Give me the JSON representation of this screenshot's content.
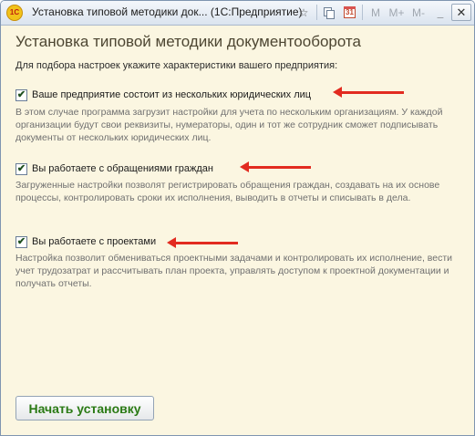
{
  "window": {
    "app_icon_text": "1С",
    "title": "Установка типовой методики док... (1С:Предприятие)",
    "toolbar": {
      "star": "☆",
      "m": "M",
      "m_plus": "M+",
      "m_minus": "M-",
      "minimize": "_",
      "maximize": "□",
      "close": "✕",
      "calendar_day": "31"
    }
  },
  "page": {
    "title": "Установка типовой методики документооборота",
    "intro": "Для подбора настроек укажите характеристики вашего предприятия:"
  },
  "options": [
    {
      "label": "Ваше предприятие состоит из нескольких юридических лиц",
      "checked": true,
      "description": "В этом случае программа загрузит настройки для учета по нескольким организациям. У каждой организации будут свои реквизиты, нумераторы, один и тот же сотрудник сможет подписывать документы от нескольких юридических лиц."
    },
    {
      "label": "Вы работаете с обращениями граждан",
      "checked": true,
      "description": "Загруженные настройки позволят регистрировать обращения граждан, создавать на их основе процессы, контролировать сроки их исполнения, выводить в отчеты и списывать в дела."
    },
    {
      "label": "Вы работаете с проектами",
      "checked": true,
      "description": "Настройка позволит обмениваться проектными задачами и контролировать их исполнение, вести учет трудозатрат и рассчитывать план проекта, управлять доступом к проектной документации и получать отчеты."
    }
  ],
  "check_mark": "✔",
  "start_button": {
    "label": "Начать установку"
  },
  "colors": {
    "background": "#fbf6e1",
    "title": "#4d4632",
    "arrow": "#e22b20",
    "button_text": "#2a7a14"
  }
}
